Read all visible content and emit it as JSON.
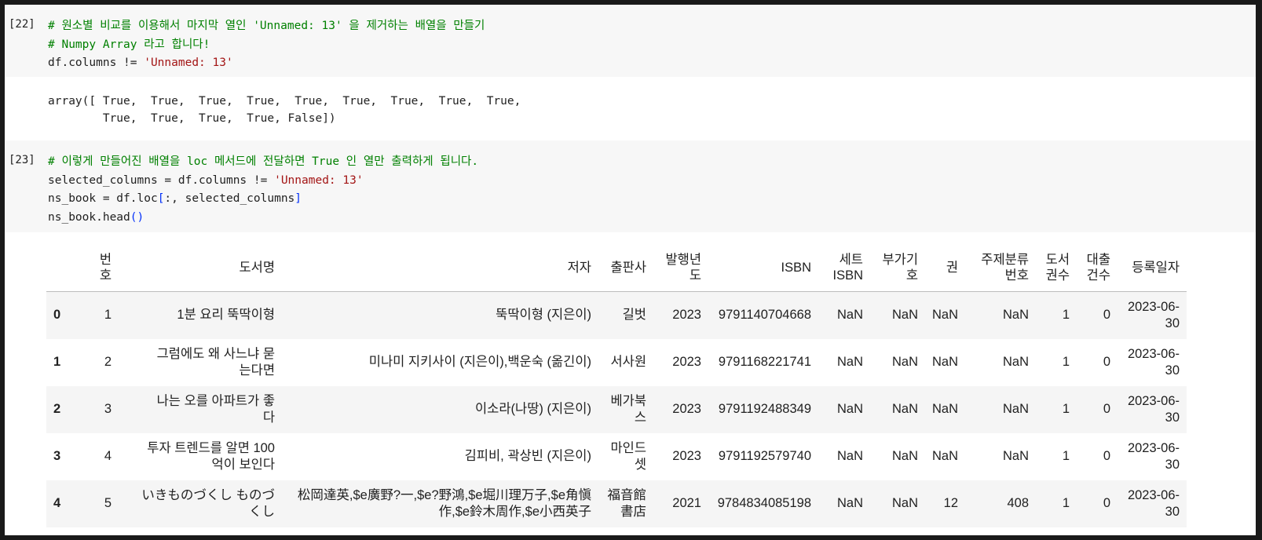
{
  "cell22": {
    "prompt": "[22]",
    "comment1": "# 원소별 비교를 이용해서 마지막 열인 'Unnamed: 13' 을 제거하는 배열을 만들기",
    "comment2": "# Numpy Array 라고 합니다!",
    "code_pre": "df.columns != ",
    "code_str": "'Unnamed: 13'",
    "output_line1": "array([ True,  True,  True,  True,  True,  True,  True,  True,  True,",
    "output_line2": "        True,  True,  True,  True, False])"
  },
  "cell23": {
    "prompt": "[23]",
    "comment1": "# 이렇게 만들어진 배열을 loc 메서드에 전달하면 True 인 열만 출력하게 됩니다.",
    "line2_pre": "selected_columns = df.columns != ",
    "line2_str": "'Unnamed: 13'",
    "line3_pre": "ns_book = df.loc",
    "line3_br1": "[",
    "line3_mid": ":, selected_columns",
    "line3_br2": "]",
    "line4_pre": "ns_book.head",
    "line4_br": "()"
  },
  "table": {
    "headers": [
      "",
      "번\n호",
      "도서명",
      "저자",
      "출판사",
      "발행년\n도",
      "ISBN",
      "세트\nISBN",
      "부가기\n호",
      "권",
      "주제분류\n번호",
      "도서\n권수",
      "대출\n건수",
      "등록일자"
    ],
    "rows": [
      [
        "0",
        "1",
        "1분 요리 뚝딱이형",
        "뚝딱이형 (지은이)",
        "길벗",
        "2023",
        "9791140704668",
        "NaN",
        "NaN",
        "NaN",
        "NaN",
        "1",
        "0",
        "2023-06-\n30"
      ],
      [
        "1",
        "2",
        "그럼에도 왜 사느냐 묻\n는다면",
        "미나미 지키사이 (지은이),백운숙 (옮긴이)",
        "서사원",
        "2023",
        "9791168221741",
        "NaN",
        "NaN",
        "NaN",
        "NaN",
        "1",
        "0",
        "2023-06-\n30"
      ],
      [
        "2",
        "3",
        "나는 오를 아파트가 좋\n다",
        "이소라(나땅) (지은이)",
        "베가북\n스",
        "2023",
        "9791192488349",
        "NaN",
        "NaN",
        "NaN",
        "NaN",
        "1",
        "0",
        "2023-06-\n30"
      ],
      [
        "3",
        "4",
        "투자 트렌드를 알면 100\n억이 보인다",
        "김피비, 곽상빈 (지은이)",
        "마인드\n셋",
        "2023",
        "9791192579740",
        "NaN",
        "NaN",
        "NaN",
        "NaN",
        "1",
        "0",
        "2023-06-\n30"
      ],
      [
        "4",
        "5",
        "いきものづくし ものづ\nくし",
        "松岡達英,$e廣野?一,$e?野鴻,$e堀川理万子,$e角愼\n作,$e鈴木周作,$e小西英子",
        "福音館\n書店",
        "2021",
        "9784834085198",
        "NaN",
        "NaN",
        "12",
        "408",
        "1",
        "0",
        "2023-06-\n30"
      ]
    ]
  },
  "colors": {
    "input_bg": "#f7f7f7",
    "comment": "#008000",
    "string": "#a31515",
    "bracket": "#0431fa",
    "striped_row": "#f5f5f5"
  }
}
